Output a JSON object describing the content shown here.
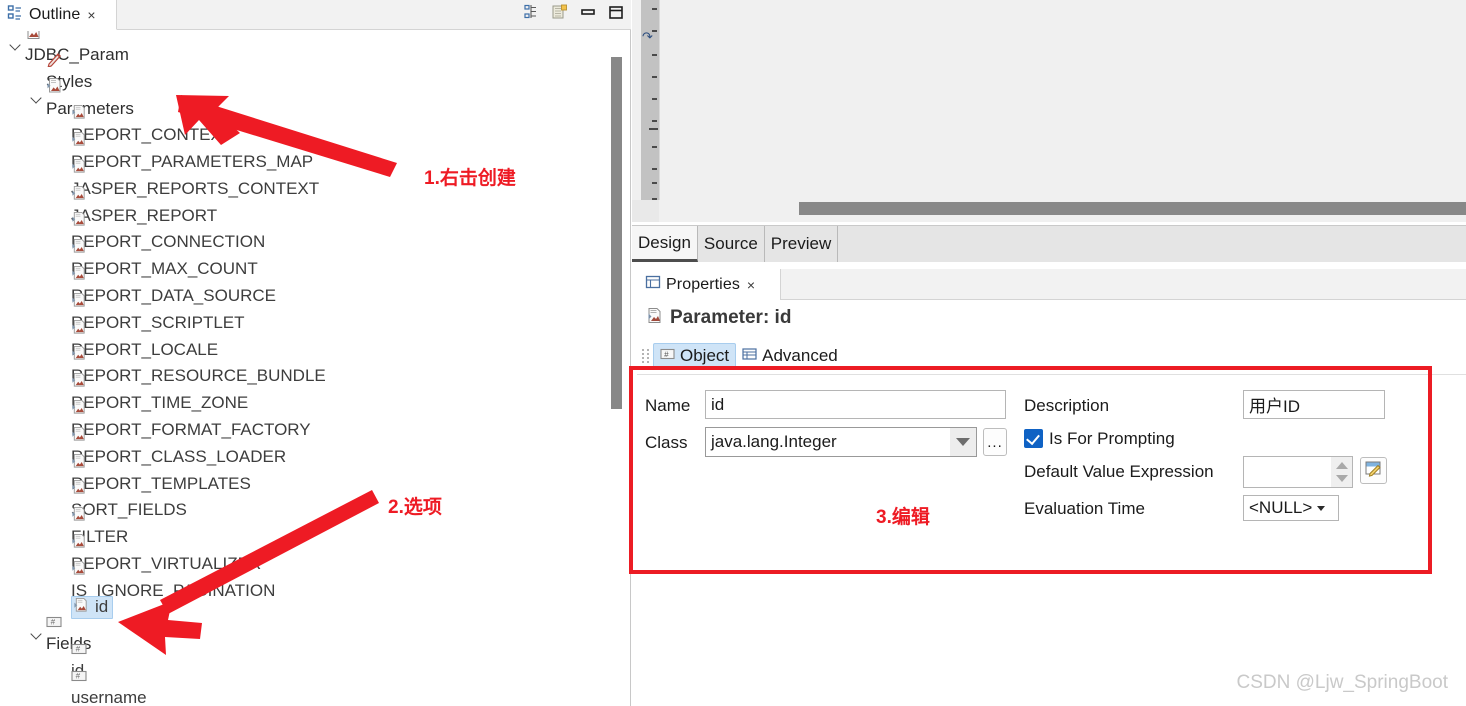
{
  "outline_view": {
    "tab_label": "Outline",
    "close_label": "×",
    "toolbar": [
      {
        "name": "hierarchical-layout-icon",
        "title": "Hierarchical Layout"
      },
      {
        "name": "collapse-all-icon",
        "title": "Collapse All"
      },
      {
        "name": "minimize-icon",
        "title": "Minimize"
      },
      {
        "name": "maximize-icon",
        "title": "Maximize"
      }
    ],
    "tree": [
      {
        "label": "JDBC_Param",
        "indent": 0,
        "icon": "report-file-icon",
        "twisty": "open",
        "selected": false
      },
      {
        "label": "Styles",
        "indent": 1,
        "icon": "pencil-icon",
        "twisty": "none",
        "selected": false
      },
      {
        "label": "Parameters",
        "indent": 1,
        "icon": "parameters-folder-icon",
        "twisty": "open",
        "selected": false
      },
      {
        "label": "REPORT_CONTEXT",
        "indent": 2,
        "icon": "parameter-icon",
        "twisty": "none",
        "selected": false
      },
      {
        "label": "REPORT_PARAMETERS_MAP",
        "indent": 2,
        "icon": "parameter-icon",
        "twisty": "none",
        "selected": false
      },
      {
        "label": "JASPER_REPORTS_CONTEXT",
        "indent": 2,
        "icon": "parameter-icon",
        "twisty": "none",
        "selected": false
      },
      {
        "label": "JASPER_REPORT",
        "indent": 2,
        "icon": "parameter-icon",
        "twisty": "none",
        "selected": false
      },
      {
        "label": "REPORT_CONNECTION",
        "indent": 2,
        "icon": "parameter-icon",
        "twisty": "none",
        "selected": false
      },
      {
        "label": "REPORT_MAX_COUNT",
        "indent": 2,
        "icon": "parameter-icon",
        "twisty": "none",
        "selected": false
      },
      {
        "label": "REPORT_DATA_SOURCE",
        "indent": 2,
        "icon": "parameter-icon",
        "twisty": "none",
        "selected": false
      },
      {
        "label": "REPORT_SCRIPTLET",
        "indent": 2,
        "icon": "parameter-icon",
        "twisty": "none",
        "selected": false
      },
      {
        "label": "REPORT_LOCALE",
        "indent": 2,
        "icon": "parameter-icon",
        "twisty": "none",
        "selected": false
      },
      {
        "label": "REPORT_RESOURCE_BUNDLE",
        "indent": 2,
        "icon": "parameter-icon",
        "twisty": "none",
        "selected": false
      },
      {
        "label": "REPORT_TIME_ZONE",
        "indent": 2,
        "icon": "parameter-icon",
        "twisty": "none",
        "selected": false
      },
      {
        "label": "REPORT_FORMAT_FACTORY",
        "indent": 2,
        "icon": "parameter-icon",
        "twisty": "none",
        "selected": false
      },
      {
        "label": "REPORT_CLASS_LOADER",
        "indent": 2,
        "icon": "parameter-icon",
        "twisty": "none",
        "selected": false
      },
      {
        "label": "REPORT_TEMPLATES",
        "indent": 2,
        "icon": "parameter-icon",
        "twisty": "none",
        "selected": false
      },
      {
        "label": "SORT_FIELDS",
        "indent": 2,
        "icon": "parameter-icon",
        "twisty": "none",
        "selected": false
      },
      {
        "label": "FILTER",
        "indent": 2,
        "icon": "parameter-icon",
        "twisty": "none",
        "selected": false
      },
      {
        "label": "REPORT_VIRTUALIZER",
        "indent": 2,
        "icon": "parameter-icon",
        "twisty": "none",
        "selected": false
      },
      {
        "label": "IS_IGNORE_PAGINATION",
        "indent": 2,
        "icon": "parameter-icon",
        "twisty": "none",
        "selected": false
      },
      {
        "label": "id",
        "indent": 2,
        "icon": "parameter-icon",
        "twisty": "none",
        "selected": true
      },
      {
        "label": "Fields",
        "indent": 1,
        "icon": "fields-folder-icon",
        "twisty": "open",
        "selected": false
      },
      {
        "label": "id",
        "indent": 2,
        "icon": "field-icon",
        "twisty": "none",
        "selected": false
      },
      {
        "label": "username",
        "indent": 2,
        "icon": "field-icon",
        "twisty": "none",
        "selected": false
      }
    ]
  },
  "editor": {
    "ruler_marker": "↷",
    "tabs": [
      {
        "label": "Design",
        "active": true
      },
      {
        "label": "Source",
        "active": false
      },
      {
        "label": "Preview",
        "active": false
      }
    ]
  },
  "properties_view": {
    "tab_label": "Properties",
    "close_label": "×",
    "title": "Parameter: id",
    "subtabs": [
      {
        "label": "Object",
        "active": true,
        "icon": "object-icon"
      },
      {
        "label": "Advanced",
        "active": false,
        "icon": "advanced-icon"
      }
    ],
    "form": {
      "name_label": "Name",
      "name_value": "id",
      "class_label": "Class",
      "class_value": "java.lang.Integer",
      "class_browse_label": "...",
      "description_label": "Description",
      "description_value": "用户ID",
      "is_for_prompting_label": "Is For Prompting",
      "is_for_prompting_checked": true,
      "default_value_expression_label": "Default Value Expression",
      "default_value_expression_value": "",
      "evaluation_time_label": "Evaluation Time",
      "evaluation_time_value": "<NULL>"
    }
  },
  "annotations": [
    {
      "id": "step-1",
      "text": "1.右击创建"
    },
    {
      "id": "step-2",
      "text": "2.选项"
    },
    {
      "id": "step-3",
      "text": "3.编辑"
    }
  ],
  "watermark": "CSDN @Ljw_SpringBoot",
  "colors": {
    "annotation_red": "#ee1b24",
    "selection_blue": "#cfe4f7",
    "checkbox_blue": "#0f62c4"
  }
}
